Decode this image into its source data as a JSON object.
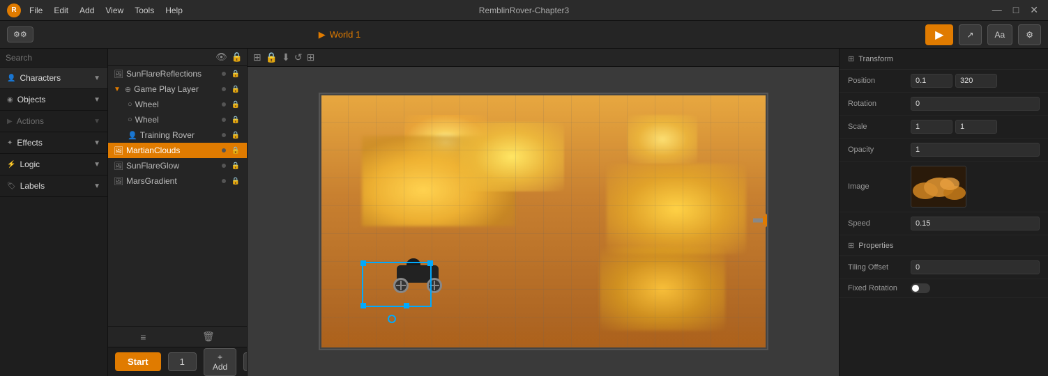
{
  "app": {
    "title": "RemblinRover-Chapter3",
    "logo": "R"
  },
  "titlebar": {
    "menu": [
      "File",
      "Edit",
      "Add",
      "View",
      "Tools",
      "Help"
    ],
    "win_buttons": [
      "—",
      "□",
      "✕"
    ]
  },
  "toolbar": {
    "team_icon": "⚙",
    "world_label": "World 1",
    "play_btn": "▶",
    "export_btn": "↗",
    "font_btn": "Aa",
    "settings_btn": "⚙"
  },
  "left_sidebar": {
    "search_placeholder": "Search",
    "sections": [
      {
        "id": "characters",
        "label": "Characters",
        "icon": "👤",
        "active": true
      },
      {
        "id": "objects",
        "label": "Objects",
        "icon": "◉",
        "active": false
      },
      {
        "id": "actions",
        "label": "Actions",
        "icon": "▶",
        "active": false,
        "disabled": true
      },
      {
        "id": "effects",
        "label": "Effects",
        "icon": "✦",
        "active": false
      },
      {
        "id": "logic",
        "label": "Logic",
        "icon": "⚡",
        "active": false
      },
      {
        "id": "labels",
        "label": "Labels",
        "icon": "🏷",
        "active": false
      }
    ]
  },
  "scene_tree": {
    "header_icons": [
      "👁",
      "🔒"
    ],
    "items": [
      {
        "id": "sunflare-reflections",
        "label": "SunFlareReflections",
        "icon": "🖼",
        "indent": 0,
        "selected": false
      },
      {
        "id": "game-play-layer",
        "label": "Game Play Layer",
        "icon": "⊕",
        "indent": 0,
        "selected": false,
        "expanded": true
      },
      {
        "id": "wheel-1",
        "label": "Wheel",
        "icon": "○",
        "indent": 1,
        "selected": false
      },
      {
        "id": "wheel-2",
        "label": "Wheel",
        "icon": "○",
        "indent": 1,
        "selected": false
      },
      {
        "id": "training-rover",
        "label": "Training Rover",
        "icon": "👤",
        "indent": 1,
        "selected": false
      },
      {
        "id": "martian-clouds",
        "label": "MartianClouds",
        "icon": "🖼",
        "indent": 0,
        "selected": true
      },
      {
        "id": "sunflare-glow",
        "label": "SunFlareGlow",
        "icon": "🖼",
        "indent": 0,
        "selected": false
      },
      {
        "id": "mars-gradient",
        "label": "MarsGradient",
        "icon": "🖼",
        "indent": 0,
        "selected": false
      }
    ],
    "footer": {
      "add_icon": "≡",
      "delete_icon": "🗑"
    }
  },
  "canvas": {
    "toolbar_icons": [
      "⚙",
      "🔒",
      "⬇",
      "↺",
      "⊞"
    ],
    "world_content": "Game scene with rover and martian clouds"
  },
  "bottom_bar": {
    "start_label": "Start",
    "count": "1",
    "add_label": "+ Add",
    "collapse_icon": "▲"
  },
  "right_panel": {
    "transform_section": "Transform",
    "properties": [
      {
        "id": "position",
        "label": "Position",
        "value1": "0.1",
        "value2": "320"
      },
      {
        "id": "rotation",
        "label": "Rotation",
        "value1": "0",
        "value2": null
      },
      {
        "id": "scale",
        "label": "Scale",
        "value1": "1",
        "value2": "1"
      },
      {
        "id": "opacity",
        "label": "Opacity",
        "value1": "1",
        "value2": null
      }
    ],
    "image_label": "Image",
    "speed_label": "Speed",
    "speed_value": "0.15",
    "properties_section": "Properties",
    "tiling_offset_label": "Tiling Offset",
    "tiling_offset_value": "0",
    "fixed_rotation_label": "Fixed Rotation"
  }
}
